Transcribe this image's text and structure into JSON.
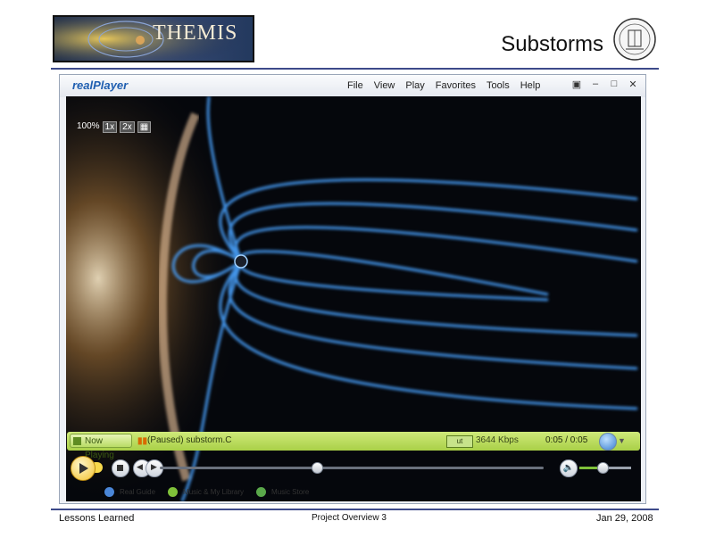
{
  "slide": {
    "logo_text": "THEMIS",
    "title": "Substorms",
    "footer_left": "Lessons Learned",
    "footer_center": "Project Overview 3",
    "footer_right": "Jan 29, 2008",
    "rule_color": "#3d4a8a"
  },
  "player": {
    "brand_real": "real",
    "brand_player": "Player",
    "menu": [
      "File",
      "View",
      "Play",
      "Favorites",
      "Tools",
      "Help"
    ],
    "window_buttons": [
      "restore-icon",
      "minimize-icon",
      "maximize-icon",
      "close-icon"
    ],
    "zoom": {
      "percent": "100%",
      "opt1": "1x",
      "opt2": "2x"
    },
    "status": {
      "tab_label": "Now Playing",
      "state_text": "(Paused) substorm.C",
      "badge": "ut",
      "bitrate": "3644 Kbps",
      "time": "0:05 / 0:05"
    },
    "seek_fraction": 0.41,
    "volume_fraction": 0.45,
    "links": [
      "Real Guide",
      "Music & My Library",
      "Music Store"
    ],
    "accent_green": "#a9d047",
    "accent_gold": "#f2c230"
  }
}
